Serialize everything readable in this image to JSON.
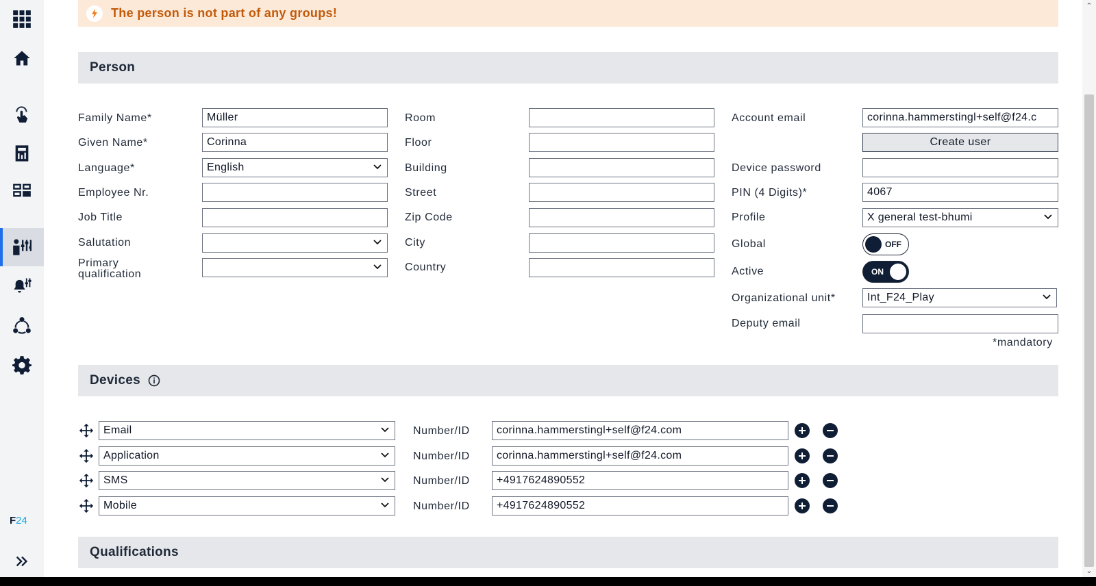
{
  "banner": {
    "message": "The person is not part of any groups!"
  },
  "sections": {
    "person": "Person",
    "devices": "Devices",
    "qualifications": "Qualifications"
  },
  "sidebar": {
    "items": [
      {
        "icon": "apps-grid-icon"
      },
      {
        "icon": "home-icon"
      },
      {
        "icon": "touch-alarm-icon"
      },
      {
        "icon": "report-icon"
      },
      {
        "icon": "dashboard-icon"
      },
      {
        "icon": "person-settings-icon",
        "active": true
      },
      {
        "icon": "alarm-settings-icon"
      },
      {
        "icon": "network-icon"
      },
      {
        "icon": "gear-icon"
      }
    ],
    "logo_f": "F",
    "logo_24": "24",
    "expand_icon": "double-chevron-right-icon"
  },
  "person": {
    "col1": {
      "family_name": {
        "label": "Family Name*",
        "value": "Müller"
      },
      "given_name": {
        "label": "Given Name*",
        "value": "Corinna"
      },
      "language": {
        "label": "Language*",
        "value": "English"
      },
      "employee_nr": {
        "label": "Employee Nr.",
        "value": ""
      },
      "job_title": {
        "label": "Job Title",
        "value": ""
      },
      "salutation": {
        "label": "Salutation",
        "value": ""
      },
      "primary_qualification": {
        "label_line1": "Primary",
        "label_line2": "qualification",
        "value": ""
      }
    },
    "col2": {
      "room": {
        "label": "Room",
        "value": ""
      },
      "floor": {
        "label": "Floor",
        "value": ""
      },
      "building": {
        "label": "Building",
        "value": ""
      },
      "street": {
        "label": "Street",
        "value": ""
      },
      "zip_code": {
        "label": "Zip Code",
        "value": ""
      },
      "city": {
        "label": "City",
        "value": ""
      },
      "country": {
        "label": "Country",
        "value": ""
      }
    },
    "col3": {
      "account_email": {
        "label": "Account email",
        "value": "corinna.hammerstingl+self@f24.c"
      },
      "create_user": "Create user",
      "device_password": {
        "label": "Device password",
        "value": ""
      },
      "pin": {
        "label": "PIN (4 Digits)*",
        "value": "4067"
      },
      "profile": {
        "label": "Profile",
        "value": "X general test-bhumi"
      },
      "global": {
        "label": "Global",
        "state": "OFF"
      },
      "active": {
        "label": "Active",
        "state": "ON"
      },
      "org_unit": {
        "label": "Organizational unit*",
        "value": "Int_F24_Play"
      },
      "deputy_email": {
        "label": "Deputy email",
        "value": ""
      },
      "mandatory_note": "*mandatory"
    }
  },
  "devices": [
    {
      "type": "Email",
      "id_label": "Number/ID",
      "value": "corinna.hammerstingl+self@f24.com"
    },
    {
      "type": "Application",
      "id_label": "Number/ID",
      "value": "corinna.hammerstingl+self@f24.com"
    },
    {
      "type": "SMS",
      "id_label": "Number/ID",
      "value": "+4917624890552"
    },
    {
      "type": "Mobile",
      "id_label": "Number/ID",
      "value": "+4917624890552"
    }
  ],
  "colors": {
    "navy": "#0f1d35",
    "banner_bg": "#fde9d8",
    "banner_text": "#c25a0a",
    "accent": "#1ea7e1"
  }
}
